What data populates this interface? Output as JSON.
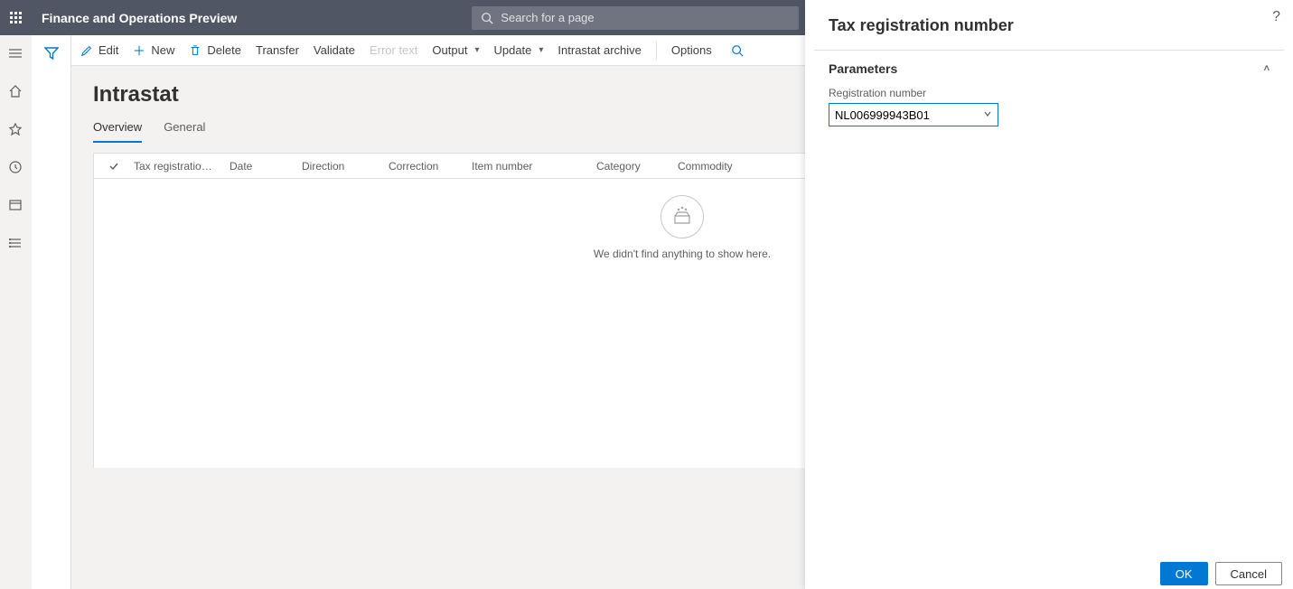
{
  "app": {
    "title": "Finance and Operations Preview",
    "search_placeholder": "Search for a page"
  },
  "nav": {
    "items": [
      "menu",
      "home",
      "favorites",
      "recent",
      "workspaces",
      "modules"
    ]
  },
  "commands": {
    "edit": "Edit",
    "new": "New",
    "delete": "Delete",
    "transfer": "Transfer",
    "validate": "Validate",
    "error_text": "Error text",
    "output": "Output",
    "update": "Update",
    "archive": "Intrastat archive",
    "options": "Options"
  },
  "page": {
    "title": "Intrastat",
    "tabs": [
      {
        "label": "Overview",
        "active": true
      },
      {
        "label": "General",
        "active": false
      }
    ],
    "columns": [
      "Tax registration num...",
      "Date",
      "Direction",
      "Correction",
      "Item number",
      "Category",
      "Commodity"
    ],
    "empty_message": "We didn't find anything to show here."
  },
  "panel": {
    "title": "Tax registration number",
    "section_title": "Parameters",
    "field_label": "Registration number",
    "field_value": "NL006999943B01",
    "ok": "OK",
    "cancel": "Cancel",
    "help": "?"
  }
}
